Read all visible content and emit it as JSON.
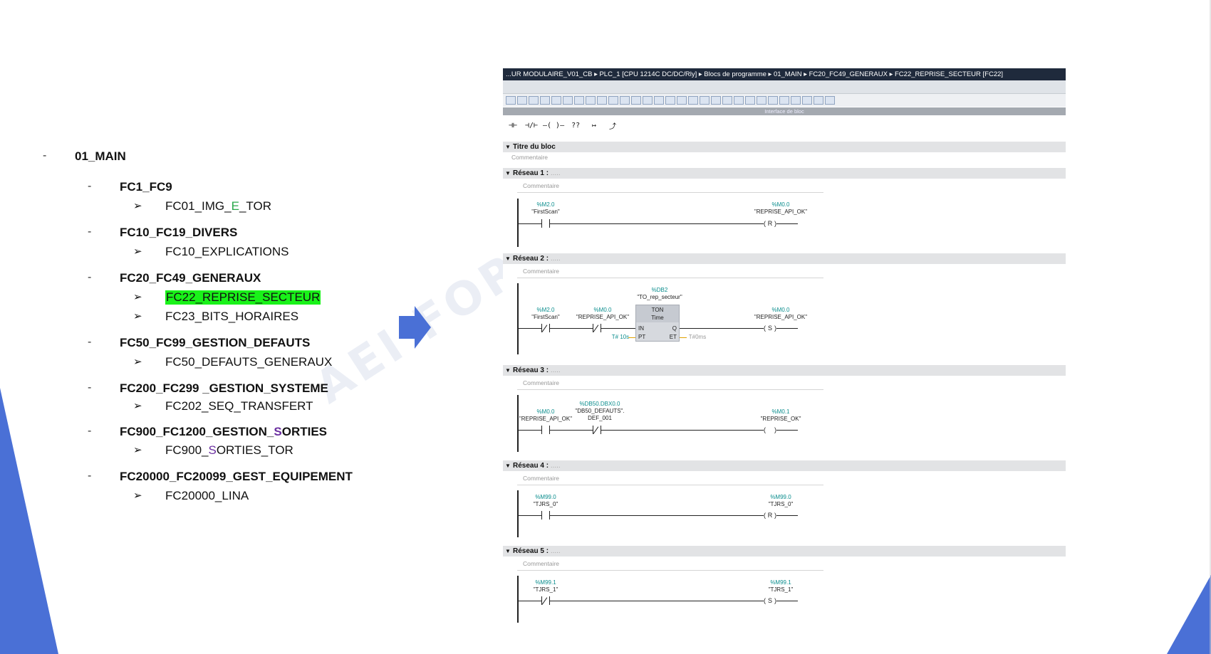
{
  "colors": {
    "accent_blue": "#4a70d6",
    "highlight": "#19f219",
    "address_teal": "#0a8d8d"
  },
  "watermark": "AEI FOR",
  "tree": {
    "root": {
      "dash": "-",
      "label": "01_MAIN"
    },
    "groups": [
      {
        "dash": "-",
        "label": "FC1_FC9",
        "children": [
          {
            "bullet": "➢",
            "parts": [
              "FC01_IMG_",
              "E",
              "_TOR"
            ]
          }
        ]
      },
      {
        "dash": "-",
        "label": "FC10_FC19_DIVERS",
        "children": [
          {
            "bullet": "➢",
            "parts": [
              "FC10_EXPLICATIONS"
            ]
          }
        ]
      },
      {
        "dash": "-",
        "label": "FC20_FC49_GENERAUX",
        "children": [
          {
            "bullet": "➢",
            "parts": [
              "FC22_REPRISE_SECTEUR"
            ]
          },
          {
            "bullet": "➢",
            "parts": [
              "FC23_BITS_HORAIRES"
            ]
          }
        ]
      },
      {
        "dash": "-",
        "label": "FC50_FC99_GESTION_DEFAUTS",
        "children": [
          {
            "bullet": "➢",
            "parts": [
              "FC50_DEFAUTS_GENERAUX"
            ]
          }
        ]
      },
      {
        "dash": "-",
        "label": "FC200_FC299 _GESTION_SYSTEME",
        "children": [
          {
            "bullet": "➢",
            "parts": [
              "FC202_SEQ_TRANSFERT"
            ]
          }
        ]
      },
      {
        "dash": "-",
        "label_parts": [
          "FC900_FC1200_GESTION_",
          "S",
          "ORTIES"
        ],
        "children": [
          {
            "bullet": "➢",
            "parts": [
              "FC900_",
              "S",
              "ORTIES_TOR"
            ]
          }
        ]
      },
      {
        "dash": "-",
        "label": "FC20000_FC20099_GEST_EQUIPEMENT",
        "children": [
          {
            "bullet": "➢",
            "parts": [
              "FC20000_LINA"
            ]
          }
        ]
      }
    ]
  },
  "editor": {
    "breadcrumb": "...UR MODULAIRE_V01_CB  ▸  PLC_1 [CPU 1214C DC/DC/Rly]  ▸  Blocs de programme  ▸  01_MAIN  ▸  FC20_FC49_GENERAUX  ▸  FC22_REPRISE_SECTEUR [FC22]",
    "interface_label": "Interface de bloc",
    "ladder_tools": [
      "⊣⊢",
      "⊣/⊢",
      "–( )–",
      "??",
      "↦",
      "⤴"
    ],
    "block_title": "Titre du bloc",
    "comment": "Commentaire",
    "networks": [
      {
        "title": "Réseau 1 :",
        "dots": ".....",
        "c1_addr": "%M2.0",
        "c1_sym": "\"FirstScan\"",
        "coil_addr": "%M0.0",
        "coil_sym": "\"REPRISE_API_OK\"",
        "coil": "R"
      },
      {
        "title": "Réseau 2 :",
        "dots": ".....",
        "c1_addr": "%M2.0",
        "c1_sym": "\"FirstScan\"",
        "c2_addr": "%M0.0",
        "c2_sym": "\"REPRISE_API_OK\"",
        "db_addr": "%DB2",
        "db_sym": "\"TO_rep_secteur\"",
        "ton": "TON",
        "ton_type": "Time",
        "in": "IN",
        "pt": "PT",
        "q": "Q",
        "et": "ET",
        "pt_val": "T# 10s",
        "et_val": "T#0ms",
        "coil_addr": "%M0.0",
        "coil_sym": "\"REPRISE_API_OK\"",
        "coil": "S"
      },
      {
        "title": "Réseau 3 :",
        "dots": ".....",
        "c1_addr": "%M0.0",
        "c1_sym": "\"REPRISE_API_OK\"",
        "c2_addr": "%DB50.DBX0.0",
        "c2_sym": "\"DB50_DEFAUTS\".",
        "c2_sym2": "DEF_001",
        "coil_addr": "%M0.1",
        "coil_sym": "\"REPRISE_OK\"",
        "coil": ""
      },
      {
        "title": "Réseau 4 :",
        "dots": ".....",
        "c1_addr": "%M99.0",
        "c1_sym": "\"TJRS_0\"",
        "coil_addr": "%M99.0",
        "coil_sym": "\"TJRS_0\"",
        "coil": "R"
      },
      {
        "title": "Réseau 5 :",
        "dots": ".....",
        "c1_addr": "%M99.1",
        "c1_sym": "\"TJRS_1\"",
        "coil_addr": "%M99.1",
        "coil_sym": "\"TJRS_1\"",
        "coil": "S"
      }
    ]
  }
}
